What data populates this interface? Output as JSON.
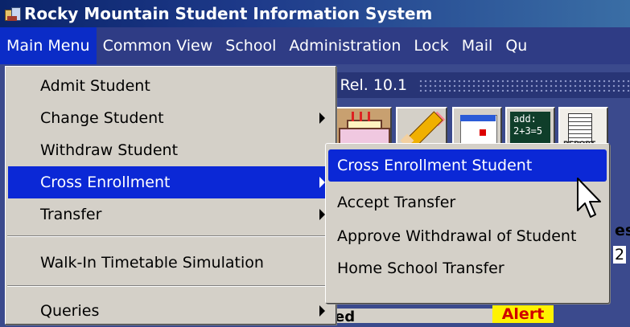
{
  "app": {
    "title": "Rocky Mountain Student Information System"
  },
  "menubar": {
    "items": [
      "Main Menu",
      "Common View",
      "School",
      "Administration",
      "Lock",
      "Mail",
      "Qu"
    ]
  },
  "background": {
    "release": ": Rel. 10.1",
    "toolbar": {
      "chalkboard_line1": "add:",
      "chalkboard_line2": "2+3=5",
      "report_label": "REPORT"
    },
    "partial_text_es": "es",
    "partial_value": "2",
    "partial_label_ed": "ed",
    "alert_label": "Alert"
  },
  "main_menu": {
    "items": [
      {
        "label": "Admit Student",
        "has_submenu": false
      },
      {
        "label": "Change Student",
        "has_submenu": true
      },
      {
        "label": "Withdraw Student",
        "has_submenu": false
      },
      {
        "label": "Cross Enrollment",
        "has_submenu": true,
        "highlighted": true
      },
      {
        "label": "Transfer",
        "has_submenu": true
      },
      {
        "label": "Walk-In Timetable Simulation",
        "has_submenu": false
      },
      {
        "label": "Queries",
        "has_submenu": true
      }
    ]
  },
  "submenu": {
    "items": [
      {
        "label": "Cross Enrollment Student",
        "highlighted": true
      },
      {
        "label": "Accept Transfer"
      },
      {
        "label": "Approve Withdrawal of Student"
      },
      {
        "label": "Home School Transfer"
      }
    ]
  },
  "colors": {
    "highlight": "#0b28d6",
    "menu_bg": "#d4d0c8",
    "titlebar": "#0a246a",
    "alert_bg": "#fff200",
    "alert_text": "#d00000"
  }
}
